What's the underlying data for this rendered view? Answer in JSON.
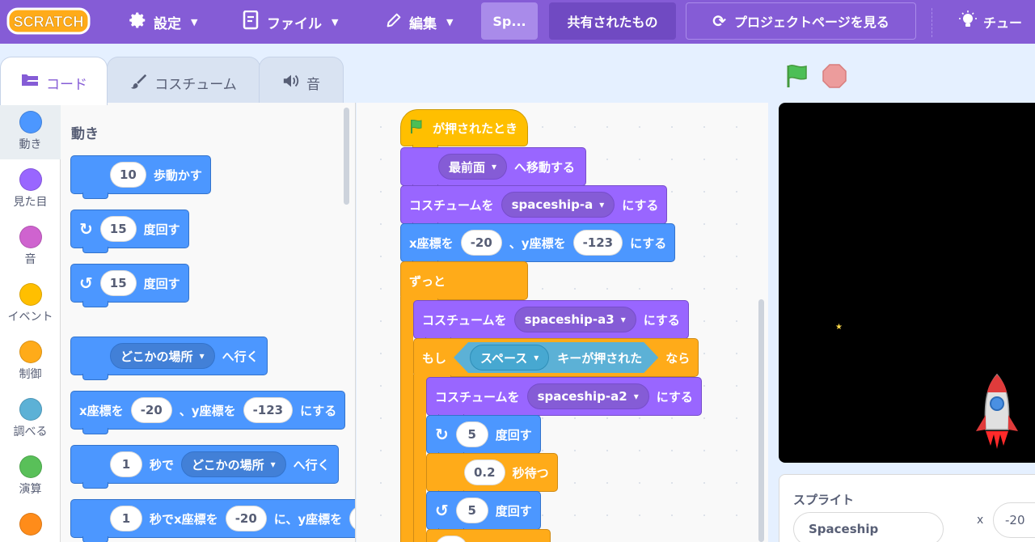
{
  "menubar": {
    "logo_text": "SCRATCH",
    "settings": "設定",
    "file": "ファイル",
    "edit": "編集",
    "project_title": "Sp...",
    "shared": "共有されたもの",
    "project_page": "プロジェクトページを見る",
    "tutorial": "チュー"
  },
  "tabs": {
    "code": "コード",
    "costumes": "コスチューム",
    "sounds": "音"
  },
  "categories": [
    {
      "label": "動き",
      "color": "#4c97ff"
    },
    {
      "label": "見た目",
      "color": "#9966ff"
    },
    {
      "label": "音",
      "color": "#cf63cf"
    },
    {
      "label": "イベント",
      "color": "#ffbf00"
    },
    {
      "label": "制御",
      "color": "#ffab19"
    },
    {
      "label": "調べる",
      "color": "#5cb1d6"
    },
    {
      "label": "演算",
      "color": "#59c059"
    },
    {
      "label": "",
      "color": "#ff8c1a"
    }
  ],
  "palette": {
    "title": "動き",
    "move": {
      "value": "10",
      "text": "歩動かす"
    },
    "turn_right": {
      "value": "15",
      "text": "度回す"
    },
    "turn_left": {
      "value": "15",
      "text": "度回す"
    },
    "goto": {
      "target": "どこかの場所",
      "text": "へ行く"
    },
    "gotoxy": {
      "x_label": "x座標を",
      "x": "-20",
      "y_label": "、y座標を",
      "y": "-123",
      "suffix": "にする"
    },
    "glide": {
      "secs": "1",
      "text": "秒で",
      "target": "どこかの場所",
      "suffix": "へ行く"
    },
    "glidexy": {
      "secs": "1",
      "text": "秒でx座標を",
      "x": "-20",
      "mid": "に、y座標を"
    }
  },
  "script": {
    "hat": "が押されたとき",
    "layer": {
      "option": "最前面",
      "suffix": "へ移動する"
    },
    "costume1": {
      "prefix": "コスチュームを",
      "option": "spaceship-a",
      "suffix": "にする"
    },
    "gotoxy": {
      "x_label": "x座標を",
      "x": "-20",
      "y_label": "、y座標を",
      "y": "-123",
      "suffix": "にする"
    },
    "forever": "ずっと",
    "costume2": {
      "prefix": "コスチュームを",
      "option": "spaceship-a3",
      "suffix": "にする"
    },
    "if": {
      "prefix": "もし",
      "key": "スペース",
      "key_suffix": "キーが押された",
      "then": "なら"
    },
    "costume3": {
      "prefix": "コスチュームを",
      "option": "spaceship-a2",
      "suffix": "にする"
    },
    "turn_r": {
      "value": "5",
      "text": "度回す"
    },
    "wait": {
      "value": "0.2",
      "text": "秒待つ"
    },
    "turn_l": {
      "value": "5",
      "text": "度回す"
    }
  },
  "sprite_info": {
    "label": "スプライト",
    "name": "Spaceship",
    "x_label": "x",
    "x": "-20"
  }
}
